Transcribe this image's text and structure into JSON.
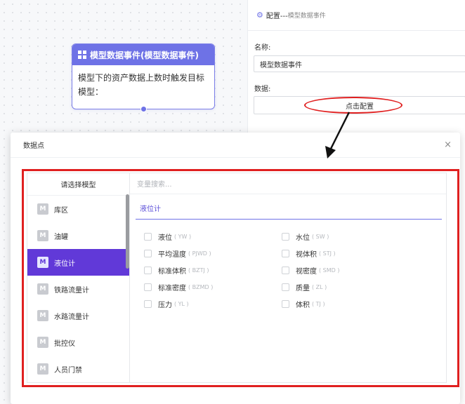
{
  "canvas": {
    "node": {
      "title": "模型数据事件(模型数据事件)",
      "description": "模型下的资产数据上数时触发目标模型："
    }
  },
  "config_panel": {
    "title": "配置---",
    "subtitle": "模型数据事件",
    "name_label": "名称:",
    "name_value": "模型数据事件",
    "data_label": "数据:",
    "config_button_label": "点击配置"
  },
  "modal": {
    "title": "数据点",
    "close_symbol": "×",
    "left_title": "请选择模型",
    "search_placeholder": "变量搜索...",
    "active_tab": "液位计",
    "models": [
      {
        "badge": "M",
        "label": "库区",
        "active": false
      },
      {
        "badge": "M",
        "label": "油罐",
        "active": false
      },
      {
        "badge": "M",
        "label": "液位计",
        "active": true
      },
      {
        "badge": "M",
        "label": "铁路流量计",
        "active": false
      },
      {
        "badge": "M",
        "label": "水路流量计",
        "active": false
      },
      {
        "badge": "M",
        "label": "批控仪",
        "active": false
      },
      {
        "badge": "M",
        "label": "人员门禁",
        "active": false
      }
    ],
    "data_points": [
      {
        "label": "液位",
        "code": "( YW )"
      },
      {
        "label": "水位",
        "code": "( SW )"
      },
      {
        "label": "平均温度",
        "code": "( PJWD )"
      },
      {
        "label": "视体积",
        "code": "( STJ )"
      },
      {
        "label": "标准体积",
        "code": "( BZTJ )"
      },
      {
        "label": "视密度",
        "code": "( SMD )"
      },
      {
        "label": "标准密度",
        "code": "( BZMD )"
      },
      {
        "label": "质量",
        "code": "( ZL )"
      },
      {
        "label": "压力",
        "code": "( YL )"
      },
      {
        "label": "体积",
        "code": "( TJ )"
      }
    ]
  },
  "colors": {
    "accent": "#6e72e6",
    "active_item": "#6139d8",
    "annotation_red": "#e02020"
  }
}
